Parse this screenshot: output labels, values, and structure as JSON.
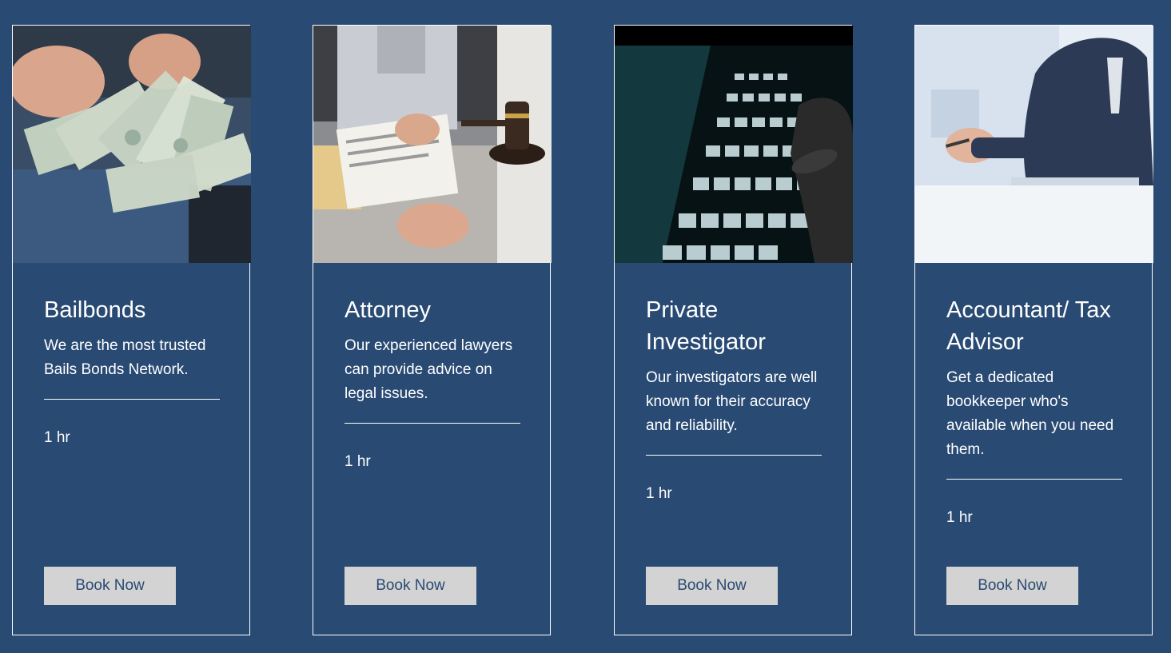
{
  "services": [
    {
      "title": "Bailbonds",
      "description": "We are the most trusted Bails Bonds Network.",
      "duration": "1 hr",
      "button_label": "Book Now",
      "image_icon": "money-photo-icon"
    },
    {
      "title": "Attorney",
      "description": "Our experienced lawyers can provide advice on legal issues.",
      "duration": "1 hr",
      "button_label": "Book Now",
      "image_icon": "gavel-photo-icon"
    },
    {
      "title": "Private Investigator",
      "description": "Our investigators are well known for their accuracy and reliability.",
      "duration": "1 hr",
      "button_label": "Book Now",
      "image_icon": "keyboard-photo-icon"
    },
    {
      "title": "Accountant/ Tax Advisor",
      "description": "Get a dedicated bookkeeper who's available when you need them.",
      "duration": "1 hr",
      "button_label": "Book Now",
      "image_icon": "businessman-photo-icon"
    }
  ],
  "colors": {
    "background": "#294a73",
    "button_bg": "#d3d3d3",
    "button_text": "#294a73",
    "text": "#ffffff"
  }
}
